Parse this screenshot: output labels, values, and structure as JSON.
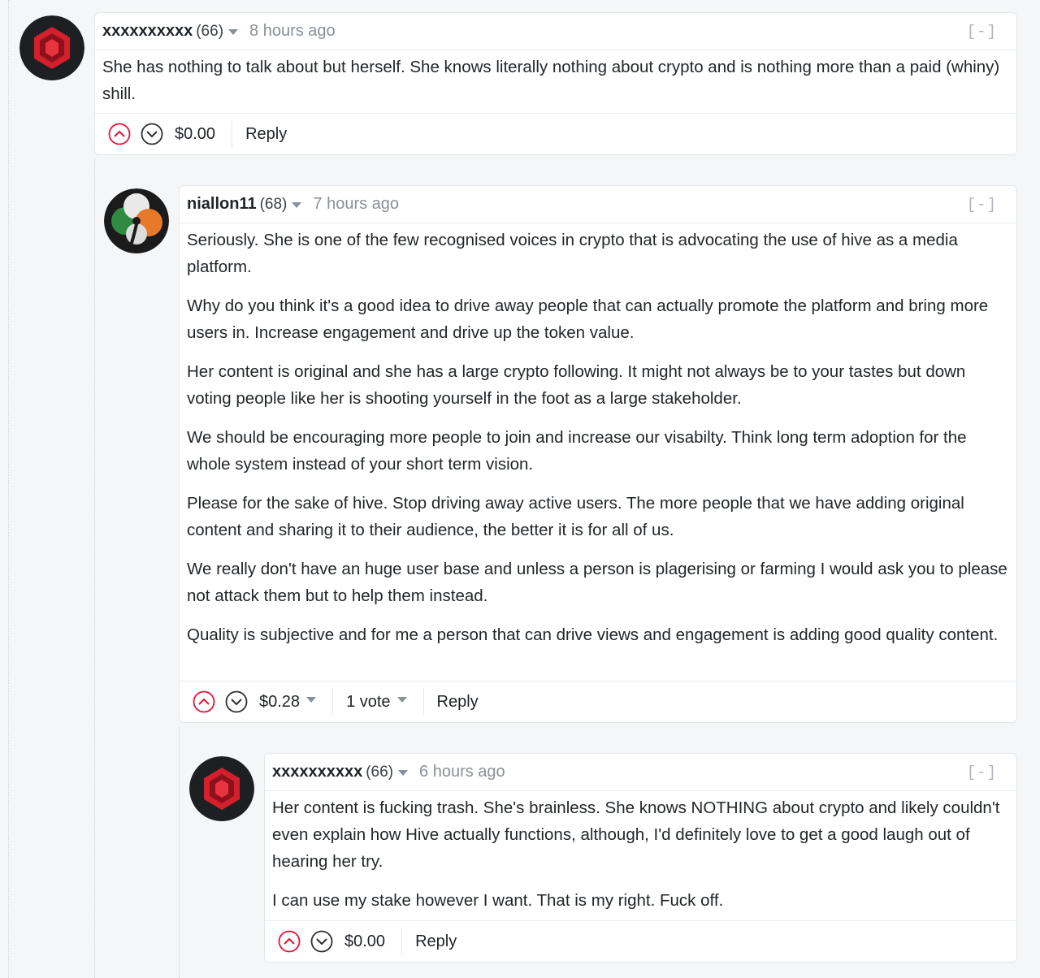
{
  "comments": [
    {
      "author": "xxxxxxxxxx",
      "reputation": "(66)",
      "time": "8 hours ago",
      "collapse": "[-]",
      "paragraphs": [
        "She has nothing to talk about but herself. She knows literally nothing about crypto and is nothing more than a paid (whiny) shill."
      ],
      "payout": "$0.00",
      "reply_label": "Reply",
      "avatar_icon": "red-hexagon-logo-icon"
    },
    {
      "author": "niallon11",
      "reputation": "(68)",
      "time": "7 hours ago",
      "collapse": "[-]",
      "paragraphs": [
        "Seriously. She is one of the few recognised voices in crypto that is advocating the use of hive as a media platform.",
        "Why do you think it's a good idea to drive away people that can actually promote the platform and bring more users in. Increase engagement and drive up the token value.",
        "Her content is original and she has a large crypto following. It might not always be to your tastes but down voting people like her is shooting yourself in the foot as a large stakeholder.",
        "We should be encouraging more people to join and increase our visabilty. Think long term adoption for the whole system instead of your short term vision.",
        "Please for the sake of hive. Stop driving away active users. The more people that we have adding original content and sharing it to their audience, the better it is for all of us.",
        "We really don't have an huge user base and unless a person is plagerising or farming I would ask you to please not attack them but to help them instead.",
        "Quality is subjective and for me a person that can drive views and engagement is adding good quality content."
      ],
      "payout": "$0.28",
      "votes": "1 vote",
      "reply_label": "Reply",
      "avatar_icon": "irish-shamrock-avatar-icon"
    },
    {
      "author": "xxxxxxxxxx",
      "reputation": "(66)",
      "time": "6 hours ago",
      "collapse": "[-]",
      "paragraphs": [
        "Her content is fucking trash. She's brainless. She knows NOTHING about crypto and likely couldn't even explain how Hive actually functions, although, I'd definitely love to get a good laugh out of hearing her try.",
        "I can use my stake however I want. That is my right. Fuck off."
      ],
      "payout": "$0.00",
      "reply_label": "Reply",
      "avatar_icon": "red-hexagon-logo-icon"
    }
  ],
  "colors": {
    "upvote": "#e31337",
    "downvote": "#2b2f33",
    "muted": "#8a9098",
    "card_border": "#e3e6ea"
  }
}
